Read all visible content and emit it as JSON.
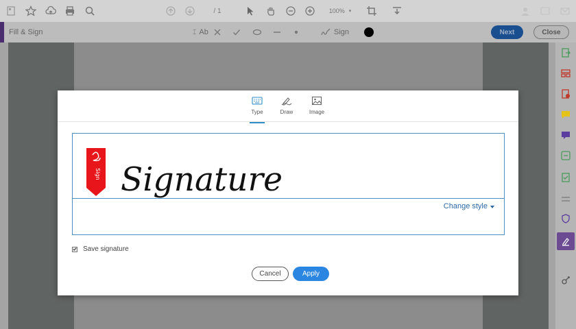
{
  "toolbar": {
    "page_indicator": "/ 1",
    "zoom": "100%",
    "icons": [
      "page-thumbnail-icon",
      "star-icon",
      "cloud-upload-icon",
      "print-icon",
      "search-icon",
      "prev-page-icon",
      "next-page-icon",
      "cursor-icon",
      "hand-icon",
      "zoom-out-icon",
      "zoom-in-icon",
      "crop-icon",
      "toolbar-dropdown-icon"
    ]
  },
  "fill_sign_bar": {
    "title": "Fill & Sign",
    "sign_label": "Sign",
    "next_label": "Next",
    "close_label": "Close",
    "tools": [
      "text-tool-icon",
      "cross-mark-icon",
      "checkmark-icon",
      "ellipse-icon",
      "line-icon",
      "dot-icon",
      "sign-pen-icon"
    ],
    "text_tool_label": "Ab",
    "dot_color": "#000000"
  },
  "dialog": {
    "tabs": [
      {
        "label": "Type",
        "icon": "keyboard-icon",
        "active": true
      },
      {
        "label": "Draw",
        "icon": "pen-draw-icon",
        "active": false
      },
      {
        "label": "Image",
        "icon": "image-icon",
        "active": false
      }
    ],
    "signature_text": "Signature",
    "flag_text": "Sign",
    "change_style_label": "Change style",
    "save_signature_label": "Save signature",
    "save_signature_checked": true,
    "cancel_label": "Cancel",
    "apply_label": "Apply",
    "accent_color": "#2a86e0",
    "flag_color": "#e8161b"
  },
  "right_rail": {
    "icons": [
      "export-pdf-icon",
      "organize-pages-icon",
      "edit-pdf-icon",
      "comment-icon",
      "redact-icon",
      "compress-icon",
      "protect-icon",
      "fill-sign-icon",
      "more-tools-icon"
    ]
  }
}
